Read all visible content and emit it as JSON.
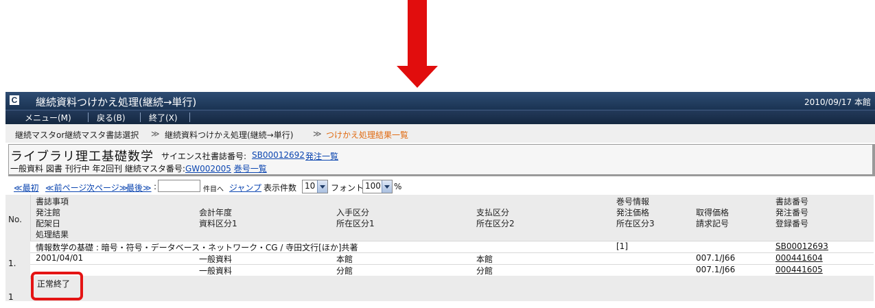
{
  "window": {
    "title": "継続資料つけかえ処理(継続→単行)",
    "date_location": "2010/09/17 本館"
  },
  "menu": {
    "items": [
      "メニュー(M)",
      "戻る(B)",
      "終了(X)"
    ]
  },
  "breadcrumb": {
    "items": [
      "継続マスタor継続マスタ書誌選択",
      "継続資料つけかえ処理(継続→単行)",
      "つけかえ処理結果一覧"
    ],
    "separator": "≫"
  },
  "record": {
    "title": "ライブラリ理工基礎数学",
    "publisher": "サイエンス社",
    "bib_label": "書誌番号:",
    "bib_number": "SB00012692",
    "order_list_link": "発注一覧",
    "info_line": "一般資料 図書 刊行中 年2回刊",
    "master_label": "継続マスタ番号:",
    "master_number": "GW002005",
    "volume_list_link": "巻号一覧"
  },
  "pager": {
    "first": "≪最初",
    "prev": "≪前ページ",
    "next": "次ページ≫",
    "last": "最後≫",
    "colon": ":",
    "page_input_value": "",
    "jump_suffix": "件目へ",
    "jump_button": "ジャンプ",
    "per_page_label": "表示件数",
    "per_page_value": "10",
    "font_label": "フォント",
    "font_value": "100",
    "font_unit": "%"
  },
  "table": {
    "headers": {
      "no": "No.",
      "bib_item": "書誌事項",
      "order_library": "発注館",
      "shelf_date": "配架日",
      "result": "処理結果",
      "fiscal_year": "会計年度",
      "material_class1": "資料区分1",
      "acquisition": "入手区分",
      "location1": "所在区分1",
      "payment": "支払区分",
      "location2": "所在区分2",
      "volume_info": "巻号情報",
      "order_price": "発注価格",
      "location3": "所在区分3",
      "acquired_price": "取得価格",
      "call_number": "請求記号",
      "bib_number": "書誌番号",
      "order_number": "発注番号",
      "registration_number": "登録番号"
    },
    "rows": [
      {
        "no": "1.",
        "bib_title": "情報数学の基礎 : 暗号・符号・データベース・ネットワーク・CG / 寺田文行[ほか]共著",
        "volume": "[1]",
        "bib_number": "SB00012693",
        "items": [
          {
            "shelf_date": "2001/04/01",
            "material_class": "一般資料",
            "location1": "本館",
            "location2": "本館",
            "call_number": "007.1/J66",
            "registration": "000441604"
          },
          {
            "shelf_date": "",
            "material_class": "一般資料",
            "location1": "分館",
            "location2": "分館",
            "call_number": "007.1/J66",
            "registration": "000441605"
          }
        ],
        "result": "正常終了"
      }
    ],
    "total_count": "1"
  },
  "colors": {
    "arrow": "#e10d0d",
    "titlebar": "#1a3352",
    "link": "#0b45b0",
    "current_crumb": "#e06a10",
    "highlight": "#e41414"
  }
}
